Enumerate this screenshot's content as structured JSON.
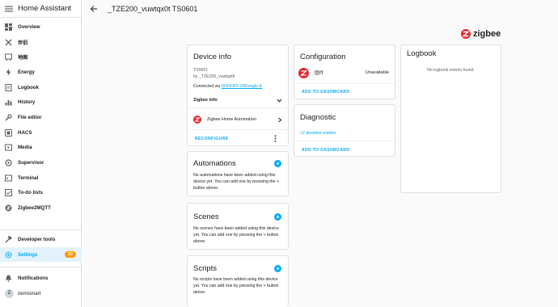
{
  "sidebar": {
    "title": "Home Assistant",
    "items": [
      {
        "label": "Overview",
        "icon": "grid-icon"
      },
      {
        "label": "伴侣",
        "icon": "tools-icon"
      },
      {
        "label": "地图",
        "icon": "map-icon"
      },
      {
        "label": "Energy",
        "icon": "lightning-icon"
      },
      {
        "label": "Logbook",
        "icon": "logbook-icon"
      },
      {
        "label": "History",
        "icon": "history-icon"
      },
      {
        "label": "File editor",
        "icon": "wrench-icon"
      },
      {
        "label": "HACS",
        "icon": "hacs-icon"
      },
      {
        "label": "Media",
        "icon": "media-icon"
      },
      {
        "label": "Supervisor",
        "icon": "supervisor-icon"
      },
      {
        "label": "Terminal",
        "icon": "terminal-icon"
      },
      {
        "label": "To-do lists",
        "icon": "todo-icon"
      },
      {
        "label": "Zigbee2MQTT",
        "icon": "zigbee-icon"
      }
    ],
    "developer_tools": "Developer tools",
    "settings": "Settings",
    "settings_badge": "10",
    "notifications": "Notifications",
    "user": "zemismart",
    "user_initial": "Z"
  },
  "header": {
    "title": "_TZE200_vuwtqx0t TS0601"
  },
  "brand": {
    "logo_text": "zigbee",
    "logo_letter": "Z"
  },
  "device_info": {
    "title": "Device info",
    "model": "TS0601",
    "manufacturer": "by _TZE200_vuwtqx0t",
    "connected_prefix": "Connected via",
    "connected_link": "SONOFF Z8Dongle-E",
    "zigbee_info": "Zigbee info",
    "integration": "Zigbee Home Automation",
    "reconfigure": "RECONFIGURE"
  },
  "automations": {
    "title": "Automations",
    "text": "No automations have been added using this device yet. You can add one by pressing the + button above."
  },
  "scenes": {
    "title": "Scenes",
    "text": "No scenes have been added using this device yet. You can add one by pressing the + button above."
  },
  "scripts": {
    "title": "Scripts",
    "text": "No scripts have been added using this device yet. You can add one by pressing the + button above."
  },
  "configuration": {
    "title": "Configuration",
    "entity": "固件",
    "state": "Unavailable",
    "add_button": "ADD TO DASHBOARD"
  },
  "diagnostic": {
    "title": "Diagnostic",
    "disabled_link": "+2 disabled entities",
    "add_button": "ADD TO DASHBOARD"
  },
  "logbook": {
    "title": "Logbook",
    "empty": "No logbook events found."
  },
  "colors": {
    "accent": "#03a9f4",
    "badge": "#ff9800",
    "zigbee_red": "#e4282c"
  }
}
